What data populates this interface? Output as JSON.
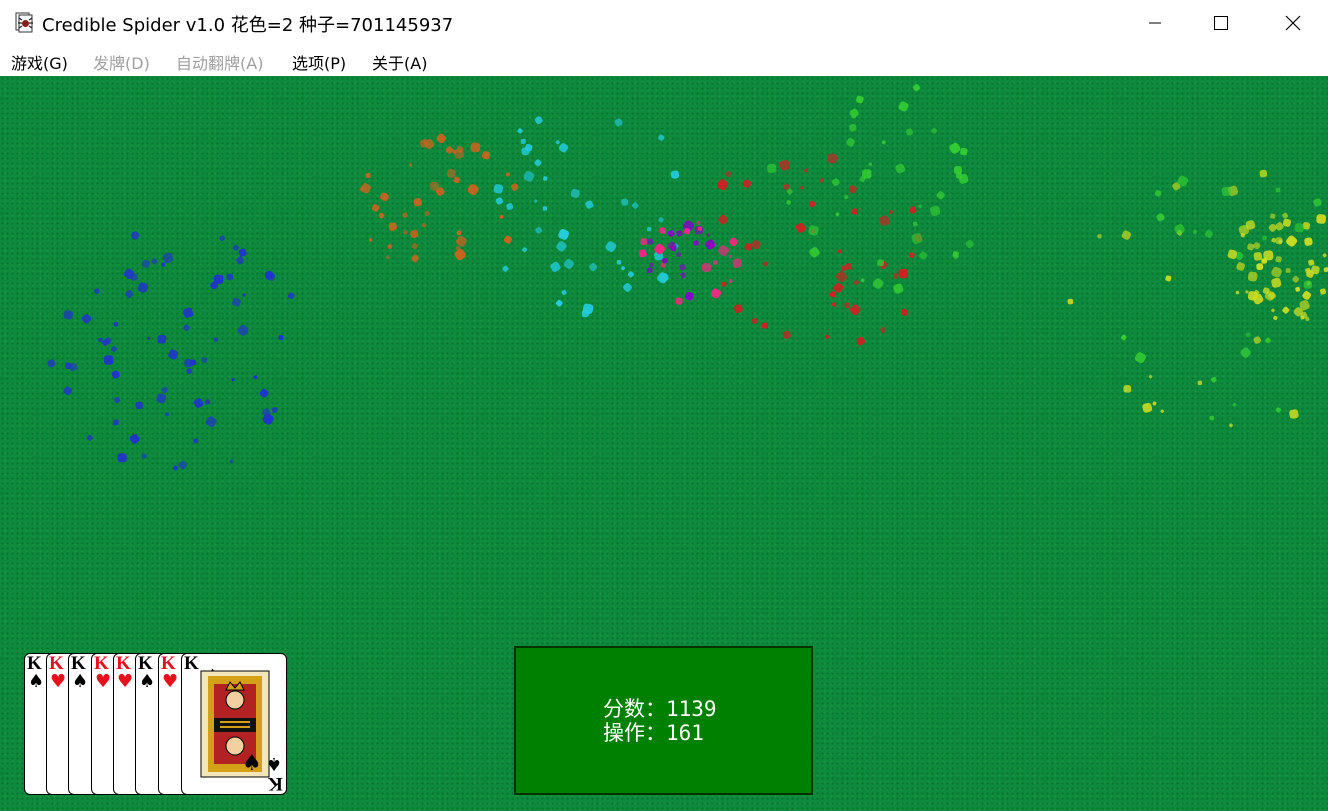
{
  "window": {
    "title": "Credible Spider v1.0 花色=2 种子=701145937",
    "icon": "spider-card-app-icon",
    "controls": [
      "minimize-icon",
      "maximize-icon",
      "close-icon"
    ]
  },
  "menu": {
    "items": [
      {
        "label": "游戏(G)",
        "enabled": true
      },
      {
        "label": "发牌(D)",
        "enabled": false
      },
      {
        "label": "自动翻牌(A)",
        "enabled": false
      },
      {
        "label": "选项(P)",
        "enabled": true
      },
      {
        "label": "关于(A)",
        "enabled": true
      }
    ]
  },
  "board": {
    "felt_color": "#0d8a3c",
    "completed_stacks": [
      {
        "rank": "K",
        "suit": "♠",
        "suit_color": "black"
      },
      {
        "rank": "K",
        "suit": "♥",
        "suit_color": "red"
      },
      {
        "rank": "K",
        "suit": "♠",
        "suit_color": "black"
      },
      {
        "rank": "K",
        "suit": "♥",
        "suit_color": "red"
      },
      {
        "rank": "K",
        "suit": "♥",
        "suit_color": "red"
      },
      {
        "rank": "K",
        "suit": "♠",
        "suit_color": "black"
      },
      {
        "rank": "K",
        "suit": "♥",
        "suit_color": "red"
      },
      {
        "rank": "K",
        "suit": "♠",
        "suit_color": "black"
      }
    ],
    "fireworks_colors": [
      "#2233cc",
      "#c8641e",
      "#22ccdd",
      "#ff2288",
      "#cc2222",
      "#33cc33",
      "#ccdd22",
      "#8800cc"
    ]
  },
  "status": {
    "score_line": "分数：1139",
    "moves_line": "操作：161"
  }
}
